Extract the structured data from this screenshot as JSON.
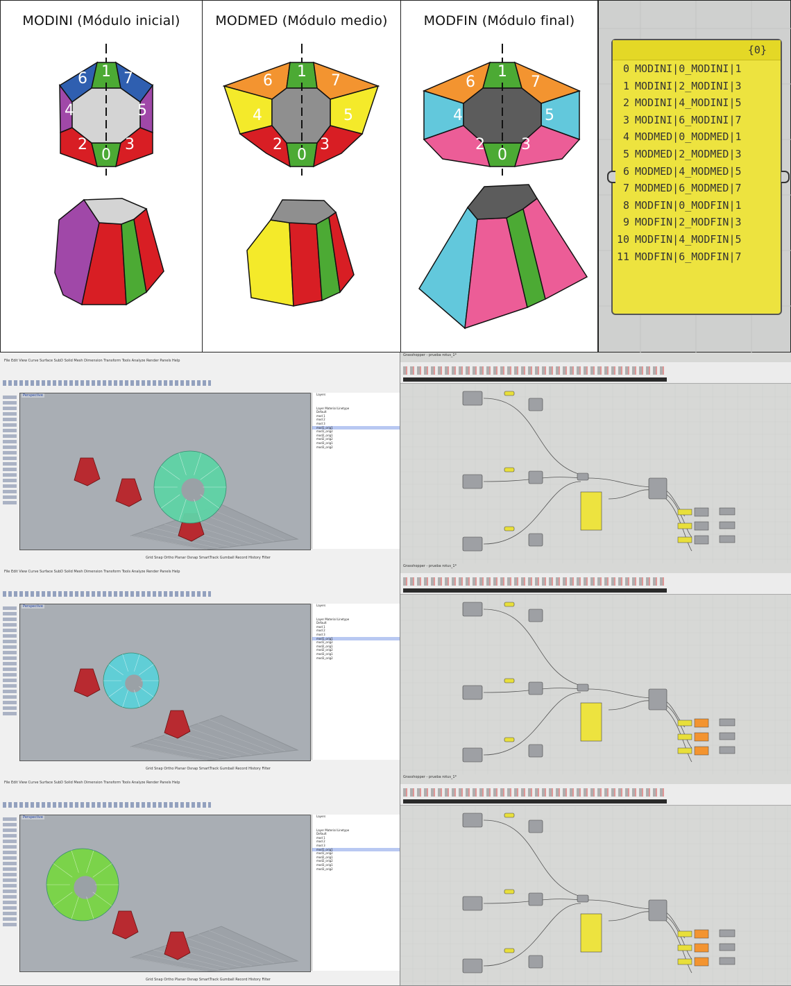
{
  "panels": [
    {
      "title": "MODINI (Módulo inicial)",
      "labels": [
        "6",
        "1",
        "7",
        "4",
        "5",
        "2",
        "0",
        "3"
      ]
    },
    {
      "title": "MODMED (Módulo medio)",
      "labels": [
        "6",
        "1",
        "7",
        "4",
        "5",
        "2",
        "0",
        "3"
      ]
    },
    {
      "title": "MODFIN (Módulo final)",
      "labels": [
        "6",
        "1",
        "7",
        "4",
        "5",
        "2",
        "0",
        "3"
      ]
    }
  ],
  "colors": {
    "modini": {
      "top_left": "#2f5fb0",
      "top": "#4caa34",
      "top_right": "#2f5fb0",
      "left": "#a048a8",
      "right": "#a048a8",
      "bottom_left": "#d81e24",
      "bottom": "#4caa34",
      "bottom_right": "#d81e24",
      "center": "#d4d4d4"
    },
    "modmed": {
      "top_left": "#f39430",
      "top": "#4caa34",
      "top_right": "#f39430",
      "left": "#f4ea2a",
      "right": "#f4ea2a",
      "bottom_left": "#d81e24",
      "bottom": "#4caa34",
      "bottom_right": "#d81e24",
      "center": "#8f8f8f"
    },
    "modfin": {
      "top_left": "#f39430",
      "top": "#4caa34",
      "top_right": "#f39430",
      "left": "#62c8dc",
      "right": "#62c8dc",
      "bottom_left": "#ec5d97",
      "bottom": "#4caa34",
      "bottom_right": "#ec5d97",
      "center": "#5c5c5c"
    }
  },
  "panel_list": {
    "header": "{0}",
    "rows": [
      {
        "i": "0",
        "v": "MODINI|0_MODINI|1"
      },
      {
        "i": "1",
        "v": "MODINI|2_MODINI|3"
      },
      {
        "i": "2",
        "v": "MODINI|4_MODINI|5"
      },
      {
        "i": "3",
        "v": "MODINI|6_MODINI|7"
      },
      {
        "i": "4",
        "v": "MODMED|0_MODMED|1"
      },
      {
        "i": "5",
        "v": "MODMED|2_MODMED|3"
      },
      {
        "i": "6",
        "v": "MODMED|4_MODMED|5"
      },
      {
        "i": "7",
        "v": "MODMED|6_MODMED|7"
      },
      {
        "i": "8",
        "v": "MODFIN|0_MODFIN|1"
      },
      {
        "i": "9",
        "v": "MODFIN|2_MODFIN|3"
      },
      {
        "i": "10",
        "v": "MODFIN|4_MODFIN|5"
      },
      {
        "i": "11",
        "v": "MODFIN|6_MODFIN|7"
      }
    ]
  },
  "screens": [
    {
      "menu": "File  Edit  View  Curve  Surface  SubD  Solid  Mesh  Dimension  Transform  Tools  Analyze  Render  Panels  Help",
      "viewport": "Perspective",
      "layers_title": "Layers",
      "cols": "Layer   Material   Linetype",
      "layers": [
        "Default",
        "mod 1",
        "mod 2",
        "mod 3",
        "mod1_orig1",
        "mod1_orig2",
        "mod2_orig1",
        "mod2_orig2",
        "mod3_orig1",
        "mod3_orig2"
      ],
      "statusbar": "Grid Snap  Ortho  Planar  Osnap  SmartTrack  Gumball  Record History  Filter",
      "gh_title": "Grasshopper - prueba rotus_1*",
      "blob": "#5fd3a6"
    },
    {
      "menu": "File  Edit  View  Curve  Surface  SubD  Solid  Mesh  Dimension  Transform  Tools  Analyze  Render  Panels  Help",
      "viewport": "Perspective",
      "layers_title": "Layers",
      "cols": "Layer   Material   Linetype",
      "layers": [
        "Default",
        "mod 1",
        "mod 2",
        "mod 3",
        "mod1_orig1",
        "mod1_orig2",
        "mod2_orig1",
        "mod2_orig2",
        "mod3_orig1",
        "mod3_orig2"
      ],
      "statusbar": "Grid Snap  Ortho  Planar  Osnap  SmartTrack  Gumball  Record History  Filter",
      "gh_title": "Grasshopper - prueba rotus_1*",
      "blob": "#5dd0d8"
    },
    {
      "menu": "File  Edit  View  Curve  Surface  SubD  Solid  Mesh  Dimension  Transform  Tools  Analyze  Render  Panels  Help",
      "viewport": "Perspective",
      "layers_title": "Layers",
      "cols": "Layer   Material   Linetype",
      "layers": [
        "Default",
        "mod 1",
        "mod 2",
        "mod 3",
        "mod1_orig1",
        "mod1_orig2",
        "mod2_orig1",
        "mod2_orig2",
        "mod3_orig1",
        "mod3_orig2"
      ],
      "statusbar": "Grid Snap  Ortho  Planar  Osnap  SmartTrack  Gumball  Record History  Filter",
      "gh_title": "Grasshopper - prueba rotus_1*",
      "blob": "#79d545"
    }
  ]
}
